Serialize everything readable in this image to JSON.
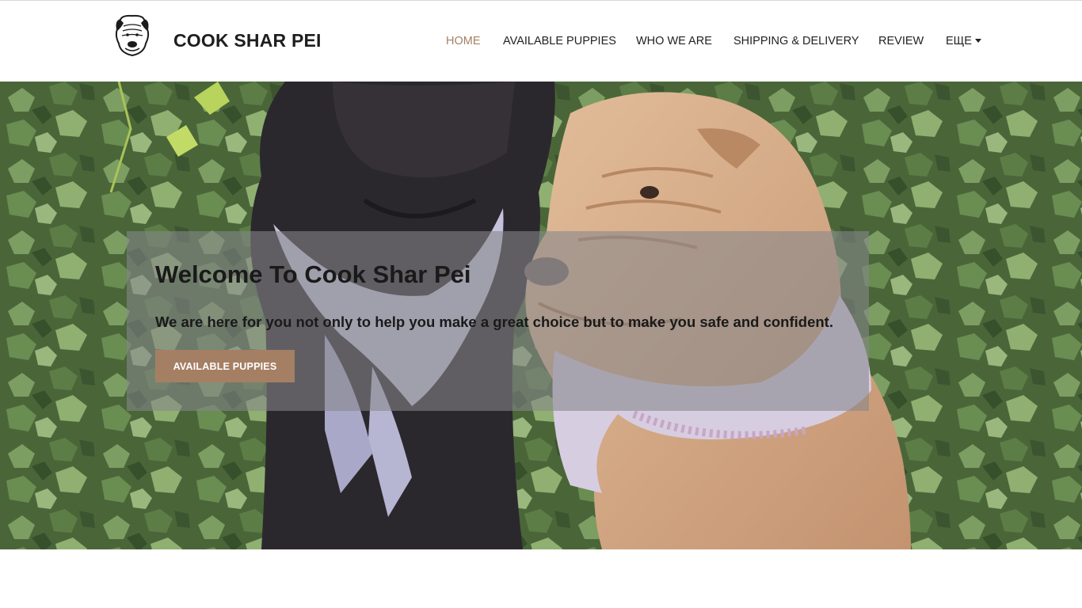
{
  "header": {
    "brand_name": "COOK SHAR PEI",
    "logo_icon": "shar-pei-head-icon"
  },
  "nav": {
    "items": [
      {
        "label": "HOME",
        "active": true
      },
      {
        "label": "AVAILABLE PUPPIES",
        "active": false
      },
      {
        "label": "WHO WE ARE",
        "active": false
      },
      {
        "label": "SHIPPING & DELIVERY",
        "active": false
      },
      {
        "label": "REVIEW",
        "active": false
      },
      {
        "label": "ЕЩЕ",
        "active": false,
        "has_dropdown": true
      }
    ]
  },
  "hero": {
    "title": "Welcome To Cook Shar Pei",
    "subtitle": "We are here for you not only to help you make a great choice but to make you safe and confident.",
    "button_label": "AVAILABLE PUPPIES"
  },
  "colors": {
    "accent": "#a57f63",
    "text_dark": "#1e1e1e",
    "foliage": "#4b6a3a",
    "black_dog": "#2a272b",
    "fawn_dog": "#d8b08d"
  }
}
